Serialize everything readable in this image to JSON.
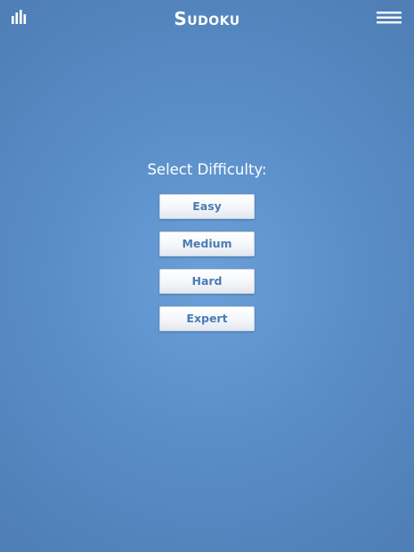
{
  "header": {
    "title": "Sudoku",
    "stats_icon": "bar-chart-icon",
    "menu_icon": "hamburger-menu-icon"
  },
  "difficulty": {
    "heading": "Select Difficulty:",
    "options": [
      "Easy",
      "Medium",
      "Hard",
      "Expert"
    ]
  },
  "colors": {
    "background_center": "#6a9fd8",
    "background_edge": "#4f7fb6",
    "button_text": "#4a7bb5",
    "header_text": "#ffffff"
  }
}
